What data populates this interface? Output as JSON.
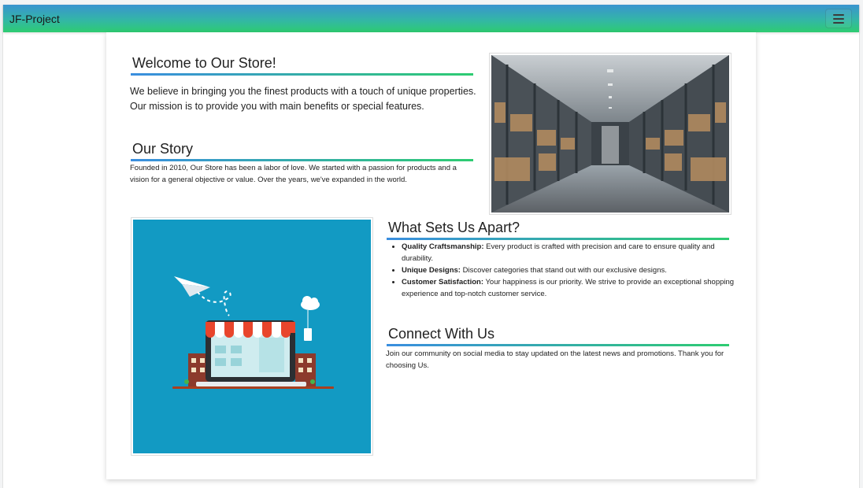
{
  "navbar": {
    "brand": "JF-Project",
    "menu_icon": "hamburger-menu-icon"
  },
  "welcome": {
    "heading": "Welcome to Our Store!",
    "text": "We believe in bringing you the finest products with a touch of unique properties. Our mission is to provide you with main benefits or special features."
  },
  "story": {
    "heading": "Our Story",
    "text": "Founded in 2010, Our Store has been a labor of love. We started with a passion for products and a vision for a general objective or value. Over the years, we've expanded in the world."
  },
  "images": {
    "warehouse": "warehouse-aisle-photo",
    "storefront": "laptop-storefront-illustration"
  },
  "apart": {
    "heading": "What Sets Us Apart?",
    "items": [
      {
        "title": "Quality Craftsmanship:",
        "text": " Every product is crafted with precision and care to ensure quality and durability."
      },
      {
        "title": "Unique Designs:",
        "text": " Discover categories that stand out with our exclusive designs."
      },
      {
        "title": "Customer Satisfaction:",
        "text": " Your happiness is our priority. We strive to provide an exceptional shopping experience and top-notch customer service."
      }
    ]
  },
  "connect": {
    "heading": "Connect With Us",
    "text": "Join our community on social media to stay updated on the latest news and promotions. Thank you for choosing Us."
  },
  "colors": {
    "nav_top": "#3a93cf",
    "nav_bottom": "#2ecc71",
    "underline_start": "#3a8ee0",
    "underline_end": "#2ecc71",
    "illustration_bg": "#129ac3"
  }
}
